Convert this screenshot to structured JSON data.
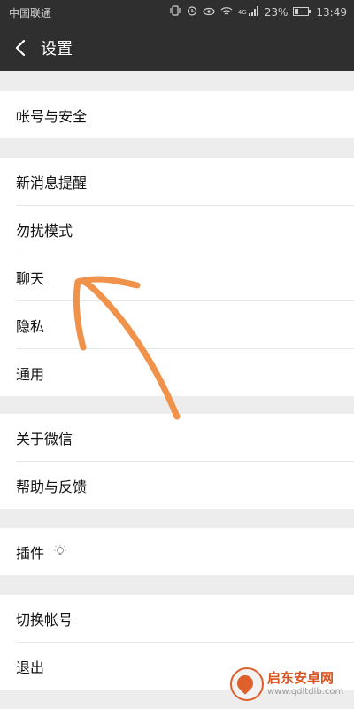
{
  "statusbar": {
    "carrier": "中国联通",
    "battery": "23%",
    "time": "13:49",
    "network": "4G"
  },
  "header": {
    "title": "设置"
  },
  "groups": [
    {
      "items": [
        {
          "label": "帐号与安全"
        }
      ]
    },
    {
      "items": [
        {
          "label": "新消息提醒"
        },
        {
          "label": "勿扰模式"
        },
        {
          "label": "聊天"
        },
        {
          "label": "隐私"
        },
        {
          "label": "通用"
        }
      ]
    },
    {
      "items": [
        {
          "label": "关于微信"
        },
        {
          "label": "帮助与反馈"
        }
      ]
    },
    {
      "items": [
        {
          "label": "插件"
        }
      ]
    },
    {
      "items": [
        {
          "label": "切换帐号"
        },
        {
          "label": "退出"
        }
      ]
    }
  ],
  "watermark": {
    "title": "启东安卓网",
    "url": "www.qdltdlb.com"
  },
  "colors": {
    "annotation": "#f0924a",
    "header_bg": "#2f2f2f",
    "page_bg": "#ededed"
  }
}
